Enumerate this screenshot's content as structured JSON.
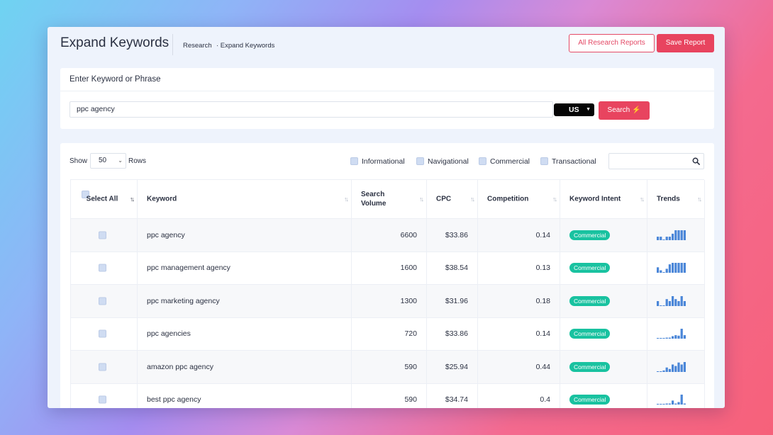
{
  "header": {
    "title": "Expand Keywords",
    "breadcrumb": [
      "Research",
      "· Expand Keywords"
    ],
    "all_reports_label": "All Research Reports",
    "save_label": "Save Report"
  },
  "search_card": {
    "heading": "Enter Keyword or Phrase",
    "keyword_value": "ppc agency",
    "country": "US",
    "search_label": "Search ⚡"
  },
  "table_controls": {
    "show_label": "Show",
    "rows_value": "50",
    "rows_label": "Rows",
    "filters": [
      "Informational",
      "Navigational",
      "Commercial",
      "Transactional"
    ],
    "search_value": ""
  },
  "columns": {
    "select_all": "Select All",
    "keyword": "Keyword",
    "search_volume": "Search Volume",
    "cpc": "CPC",
    "competition": "Competition",
    "intent": "Keyword Intent",
    "trends": "Trends"
  },
  "rows": [
    {
      "keyword": "ppc agency",
      "volume": "6600",
      "cpc": "$33.86",
      "competition": "0.14",
      "intent": "Commercial",
      "trend": [
        0.35,
        0.35,
        0.05,
        0.35,
        0.35,
        0.65,
        1,
        1,
        1,
        1
      ]
    },
    {
      "keyword": "ppc management agency",
      "volume": "1600",
      "cpc": "$38.54",
      "competition": "0.13",
      "intent": "Commercial",
      "trend": [
        0.55,
        0.25,
        0.05,
        0.4,
        0.85,
        1,
        1,
        1,
        1,
        1
      ]
    },
    {
      "keyword": "ppc marketing agency",
      "volume": "1300",
      "cpc": "$31.96",
      "competition": "0.18",
      "intent": "Commercial",
      "trend": [
        0.5,
        0.05,
        0.05,
        0.7,
        0.5,
        1,
        0.7,
        0.5,
        1,
        0.5
      ]
    },
    {
      "keyword": "ppc agencies",
      "volume": "720",
      "cpc": "$33.86",
      "competition": "0.14",
      "intent": "Commercial",
      "trend": [
        0.05,
        0.05,
        0.05,
        0.1,
        0.1,
        0.25,
        0.35,
        0.3,
        1,
        0.35
      ]
    },
    {
      "keyword": "amazon ppc agency",
      "volume": "590",
      "cpc": "$25.94",
      "competition": "0.44",
      "intent": "Commercial",
      "trend": [
        0.05,
        0.05,
        0.15,
        0.45,
        0.3,
        0.75,
        0.6,
        0.95,
        0.75,
        1
      ]
    },
    {
      "keyword": "best ppc agency",
      "volume": "590",
      "cpc": "$34.74",
      "competition": "0.4",
      "intent": "Commercial",
      "trend": [
        0.05,
        0.05,
        0.05,
        0.1,
        0.1,
        0.4,
        0.1,
        0.25,
        1,
        0.1
      ]
    }
  ],
  "colors": {
    "accent": "#e8445f",
    "intent_pill": "#19c2a0",
    "trend_bar": "#4a86d8",
    "checkbox": "#cfdcf2"
  }
}
